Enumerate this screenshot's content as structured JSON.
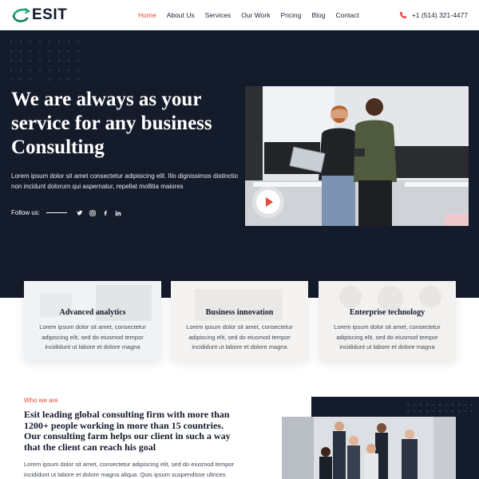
{
  "brand": {
    "name": "ESIT",
    "logo_icon": "globe-swoosh-icon"
  },
  "nav": {
    "items": [
      {
        "label": "Home",
        "active": true
      },
      {
        "label": "About Us",
        "active": false
      },
      {
        "label": "Services",
        "active": false
      },
      {
        "label": "Our Work",
        "active": false
      },
      {
        "label": "Pricing",
        "active": false
      },
      {
        "label": "Blog",
        "active": false
      },
      {
        "label": "Contact",
        "active": false
      }
    ]
  },
  "contact": {
    "phone": "+1 (514) 321-4477",
    "icon": "phone-icon"
  },
  "hero": {
    "title": "We are always as your service for any business Consulting",
    "text": "Lorem ipsum dolor sit amet consectetur adipisicing elit. Illo dignissimos distinctio non incidunt dolorum qui aspernatur, repellat mollitia maiores",
    "follow_label": "Follow us:",
    "social": [
      "twitter-icon",
      "instagram-icon",
      "facebook-icon",
      "linkedin-icon"
    ],
    "video_icon": "play-icon"
  },
  "features": [
    {
      "title": "Advanced analytics",
      "text": "Lorem ipsum dolor sit amet, consectetur adipiscing elit, sed do eiusmod tempor incididunt ut labore et dolore magna"
    },
    {
      "title": "Business innovation",
      "text": "Lorem ipsum dolor sit amet, consectetur adipiscing elit, sed do eiusmod tempor incididunt ut labore et dolore magna"
    },
    {
      "title": "Enterprise technology",
      "text": "Lorem ipsum dolor sit amet, consectetur adipiscing elit, sed do eiusmod tempor incididunt ut labore et dolore magna"
    }
  ],
  "about": {
    "eyebrow": "Who we are",
    "title": "Esit leading global consulting firm with more than 1200+ people working in more than 15 countries. Our consulting farm helps our client in such a way that the client can reach his goal",
    "text": "Lorem ipsum dolor sit amet, consectetur adipiscing elit, sed do eiusmod tempor incididunt ut labore et dolore magna aliqua. Quis ipsum suspendisse ultrices"
  },
  "colors": {
    "accent": "#e5473d",
    "dark": "#141b2a",
    "brand_green": "#1aa37a"
  }
}
